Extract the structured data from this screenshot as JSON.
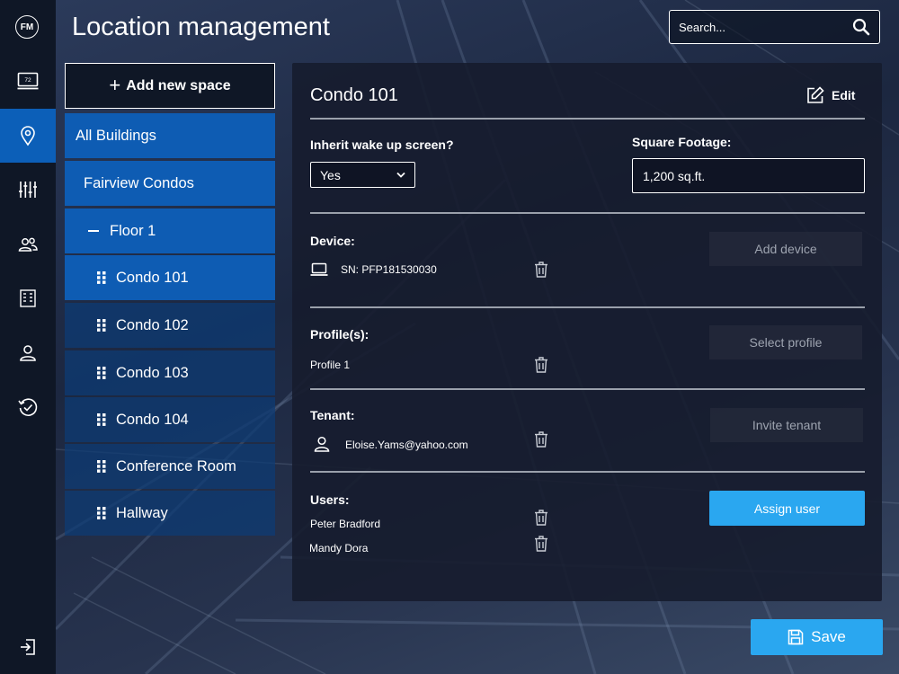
{
  "header": {
    "logo": "FM",
    "title": "Location management",
    "search_placeholder": "Search..."
  },
  "rail": {
    "items": [
      {
        "icon": "monitor-icon",
        "badge": "72"
      },
      {
        "icon": "location-pin-icon",
        "active": true
      },
      {
        "icon": "sliders-icon"
      },
      {
        "icon": "users-icon"
      },
      {
        "icon": "building-icon"
      },
      {
        "icon": "user-icon"
      },
      {
        "icon": "history-check-icon"
      }
    ],
    "bottom_icon": "logout-icon"
  },
  "tree": {
    "add_label": "Add new space",
    "items": [
      {
        "label": "All Buildings",
        "level": 0
      },
      {
        "label": "Fairview Condos",
        "level": 1
      },
      {
        "label": "Floor 1",
        "level": 2
      },
      {
        "label": "Condo 101",
        "level": 3,
        "selected": true
      },
      {
        "label": "Condo 102",
        "level": 3
      },
      {
        "label": "Condo 103",
        "level": 3
      },
      {
        "label": "Condo 104",
        "level": 3
      },
      {
        "label": "Conference Room",
        "level": 3
      },
      {
        "label": "Hallway",
        "level": 3
      }
    ]
  },
  "detail": {
    "title": "Condo 101",
    "edit_label": "Edit",
    "inherit_label": "Inherit wake up screen?",
    "inherit_value": "Yes",
    "sqft_label": "Square Footage:",
    "sqft_value": "1,200 sq.ft.",
    "device_label": "Device:",
    "device_sn": "SN: PFP181530030",
    "add_device_label": "Add device",
    "profiles_label": "Profile(s):",
    "profile_name": "Profile 1",
    "select_profile_label": "Select profile",
    "tenant_label": "Tenant:",
    "tenant_email": "Eloise.Yams@yahoo.com",
    "invite_tenant_label": "Invite tenant",
    "users_label": "Users:",
    "users": [
      "Peter Bradford",
      "Mandy Dora"
    ],
    "assign_user_label": "Assign user"
  },
  "footer": {
    "save_label": "Save"
  },
  "colors": {
    "accent": "#0e5cb3",
    "primary_button": "#2aa7f0",
    "rail_bg": "#0f1726"
  }
}
